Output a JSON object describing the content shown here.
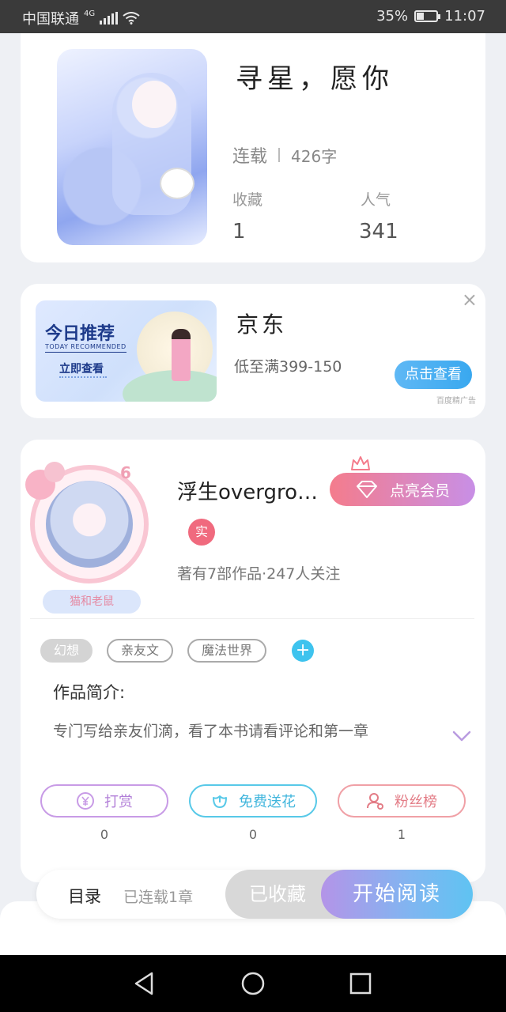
{
  "status_bar": {
    "carrier": "中国联通",
    "network": "4G",
    "battery": "35%",
    "time": "11:07"
  },
  "book": {
    "title": "寻星，愿你",
    "status": "连载",
    "word_count": "426字",
    "stats": [
      {
        "label": "收藏",
        "value": "1"
      },
      {
        "label": "人气",
        "value": "341"
      }
    ]
  },
  "ad": {
    "banner_title": "今日推荐",
    "banner_subtitle": "TODAY RECOMMENDED",
    "banner_cta": "立即查看",
    "title": "京东",
    "description": "低至满399-150",
    "button": "点击查看",
    "source": "百度精广告",
    "close": "×"
  },
  "author": {
    "name": "浮生overgro…",
    "level": "6",
    "nickname_badge": "猫和老鼠",
    "vip_button": "点亮会员",
    "real_badge": "实",
    "stats": "著有7部作品·247人关注"
  },
  "tags": [
    "幻想",
    "亲友文",
    "魔法世界"
  ],
  "tag_add": "+",
  "intro": {
    "title": "作品简介:",
    "text": "专门写给亲友们滴，看了本书请看评论和第一章"
  },
  "actions": [
    {
      "label": "打赏",
      "icon": "yen-coin-icon",
      "count": "0"
    },
    {
      "label": "免费送花",
      "icon": "flower-icon",
      "count": "0"
    },
    {
      "label": "粉丝榜",
      "icon": "fans-icon",
      "count": "1"
    }
  ],
  "bottom_bar": {
    "toc": "目录",
    "toc_sub": "已连载1章",
    "collected": "已收藏",
    "read": "开始阅读"
  },
  "colors": {
    "vip_gradient_start": "#f47c8c",
    "vip_gradient_end": "#c88fe6",
    "ad_button": "#39a8ef",
    "read_gradient_end": "#5fc3f2"
  }
}
